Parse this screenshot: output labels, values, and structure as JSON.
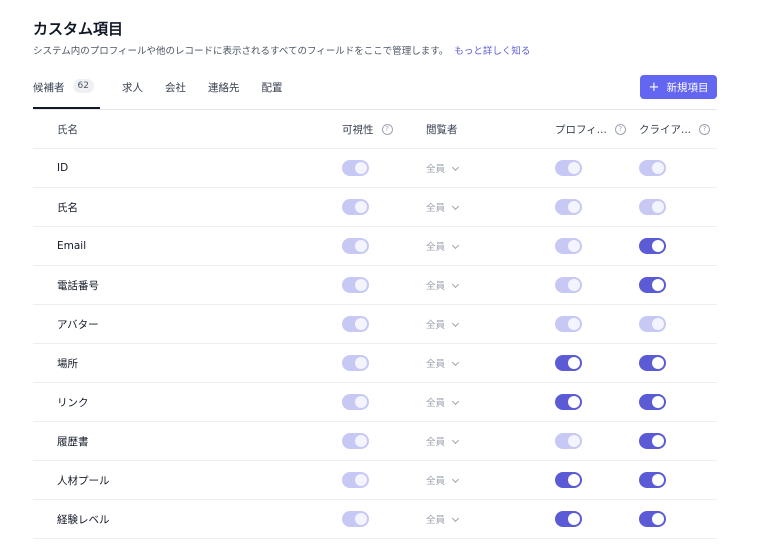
{
  "page": {
    "title": "カスタム項目",
    "subtitle": "システム内のプロフィールや他のレコードに表示されるすべてのフィールドをここで管理します。",
    "learn_more": "もっと詳しく知る"
  },
  "tabs": [
    {
      "label": "候補者",
      "count": "62",
      "active": true
    },
    {
      "label": "求人"
    },
    {
      "label": "会社"
    },
    {
      "label": "連絡先"
    },
    {
      "label": "配置"
    }
  ],
  "add_button": {
    "label": "新規項目",
    "icon": "plus-icon"
  },
  "table": {
    "headers": {
      "name": "氏名",
      "visibility": "可視性",
      "viewer": "閲覧者",
      "profile": "プロフィ...",
      "client": "クライア..."
    },
    "rows": [
      {
        "name": "ID",
        "viewer": "全員",
        "visibility": "dim",
        "profile": "dim",
        "client": "dim"
      },
      {
        "name": "氏名",
        "viewer": "全員",
        "visibility": "dim",
        "profile": "dim",
        "client": "dim"
      },
      {
        "name": "Email",
        "viewer": "全員",
        "visibility": "dim",
        "profile": "dim",
        "client": "on"
      },
      {
        "name": "電話番号",
        "viewer": "全員",
        "visibility": "dim",
        "profile": "dim",
        "client": "on"
      },
      {
        "name": "アバター",
        "viewer": "全員",
        "visibility": "dim",
        "profile": "dim",
        "client": "dim"
      },
      {
        "name": "場所",
        "viewer": "全員",
        "visibility": "dim",
        "profile": "on",
        "client": "on"
      },
      {
        "name": "リンク",
        "viewer": "全員",
        "visibility": "dim",
        "profile": "on",
        "client": "on"
      },
      {
        "name": "履歴書",
        "viewer": "全員",
        "visibility": "dim",
        "profile": "dim",
        "client": "on"
      },
      {
        "name": "人材プール",
        "viewer": "全員",
        "visibility": "dim",
        "profile": "on",
        "client": "on"
      },
      {
        "name": "経験レベル",
        "viewer": "全員",
        "visibility": "dim",
        "profile": "on",
        "client": "on"
      }
    ]
  },
  "colors": {
    "accent": "#5b5bd6",
    "toggle_dim": "#c7c9f4",
    "button": "#6366f1"
  }
}
